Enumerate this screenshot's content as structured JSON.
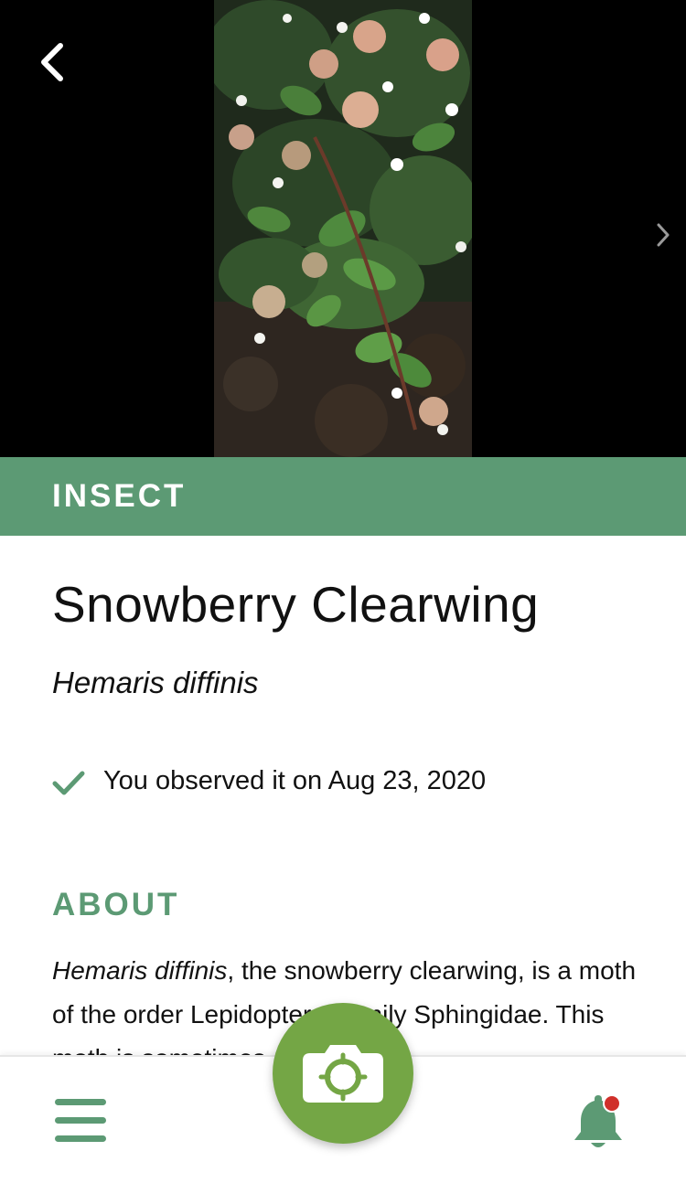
{
  "header": {
    "back_icon": "chevron-left-icon",
    "next_icon": "chevron-right-icon",
    "photo_subject": "flowering shrub photo"
  },
  "category": "INSECT",
  "species": {
    "common_name": "Snowberry Clearwing",
    "scientific_name": "Hemaris diffinis"
  },
  "observation": {
    "icon": "checkmark-icon",
    "text": "You observed it on Aug 23, 2020"
  },
  "about": {
    "heading": "ABOUT",
    "text_italic": "Hemaris diffinis",
    "text_rest": ", the snowberry clearwing, is a moth of the order Lepidoptera, family Sphingidae. This moth is sometimes called"
  },
  "bottom_nav": {
    "menu_icon": "hamburger-menu-icon",
    "camera_icon": "camera-icon",
    "bell_icon": "bell-icon",
    "notification_badge": true
  },
  "colors": {
    "accent_green": "#5c9a74",
    "camera_green": "#74a645",
    "badge_red": "#d0302a"
  }
}
